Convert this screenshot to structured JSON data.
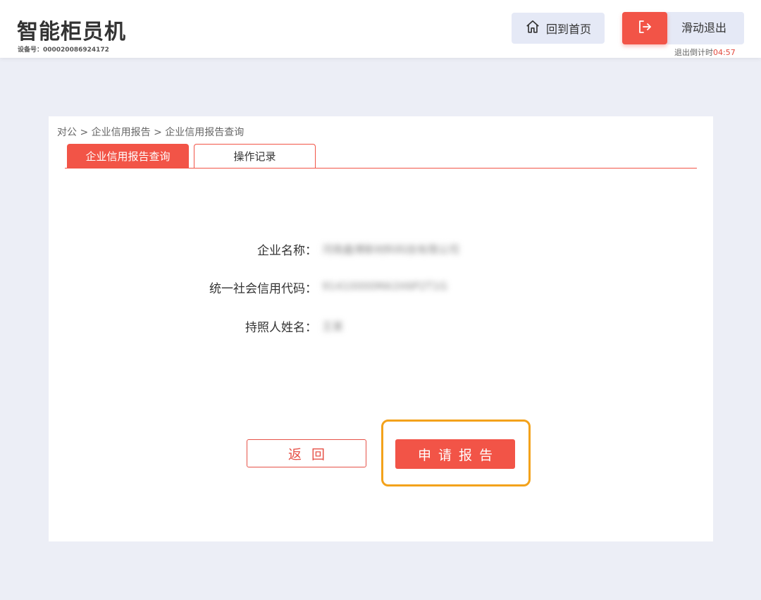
{
  "header": {
    "app_title": "智能柜员机",
    "device_no": "设备号：000020086924172",
    "home_label": "回到首页",
    "exit_label": "滑动退出",
    "countdown_prefix": "退出倒计时",
    "countdown_time": "04:57"
  },
  "breadcrumb": "对公 > 企业信用报告 > 企业信用报告查询",
  "tabs": [
    {
      "label": "企业信用报告查询",
      "active": true
    },
    {
      "label": "操作记录",
      "active": false
    }
  ],
  "fields": [
    {
      "label": "企业名称：",
      "value": "河南鑫博新材料科技有限公司"
    },
    {
      "label": "统一社会信用代码：",
      "value": "91410000MA3X6P2T1G"
    },
    {
      "label": "持照人姓名：",
      "value": "王某"
    }
  ],
  "buttons": {
    "back": "返回",
    "apply": "申请报告"
  },
  "colors": {
    "accent": "#f25447",
    "highlight": "#f3a21b",
    "background": "#eceef6"
  }
}
